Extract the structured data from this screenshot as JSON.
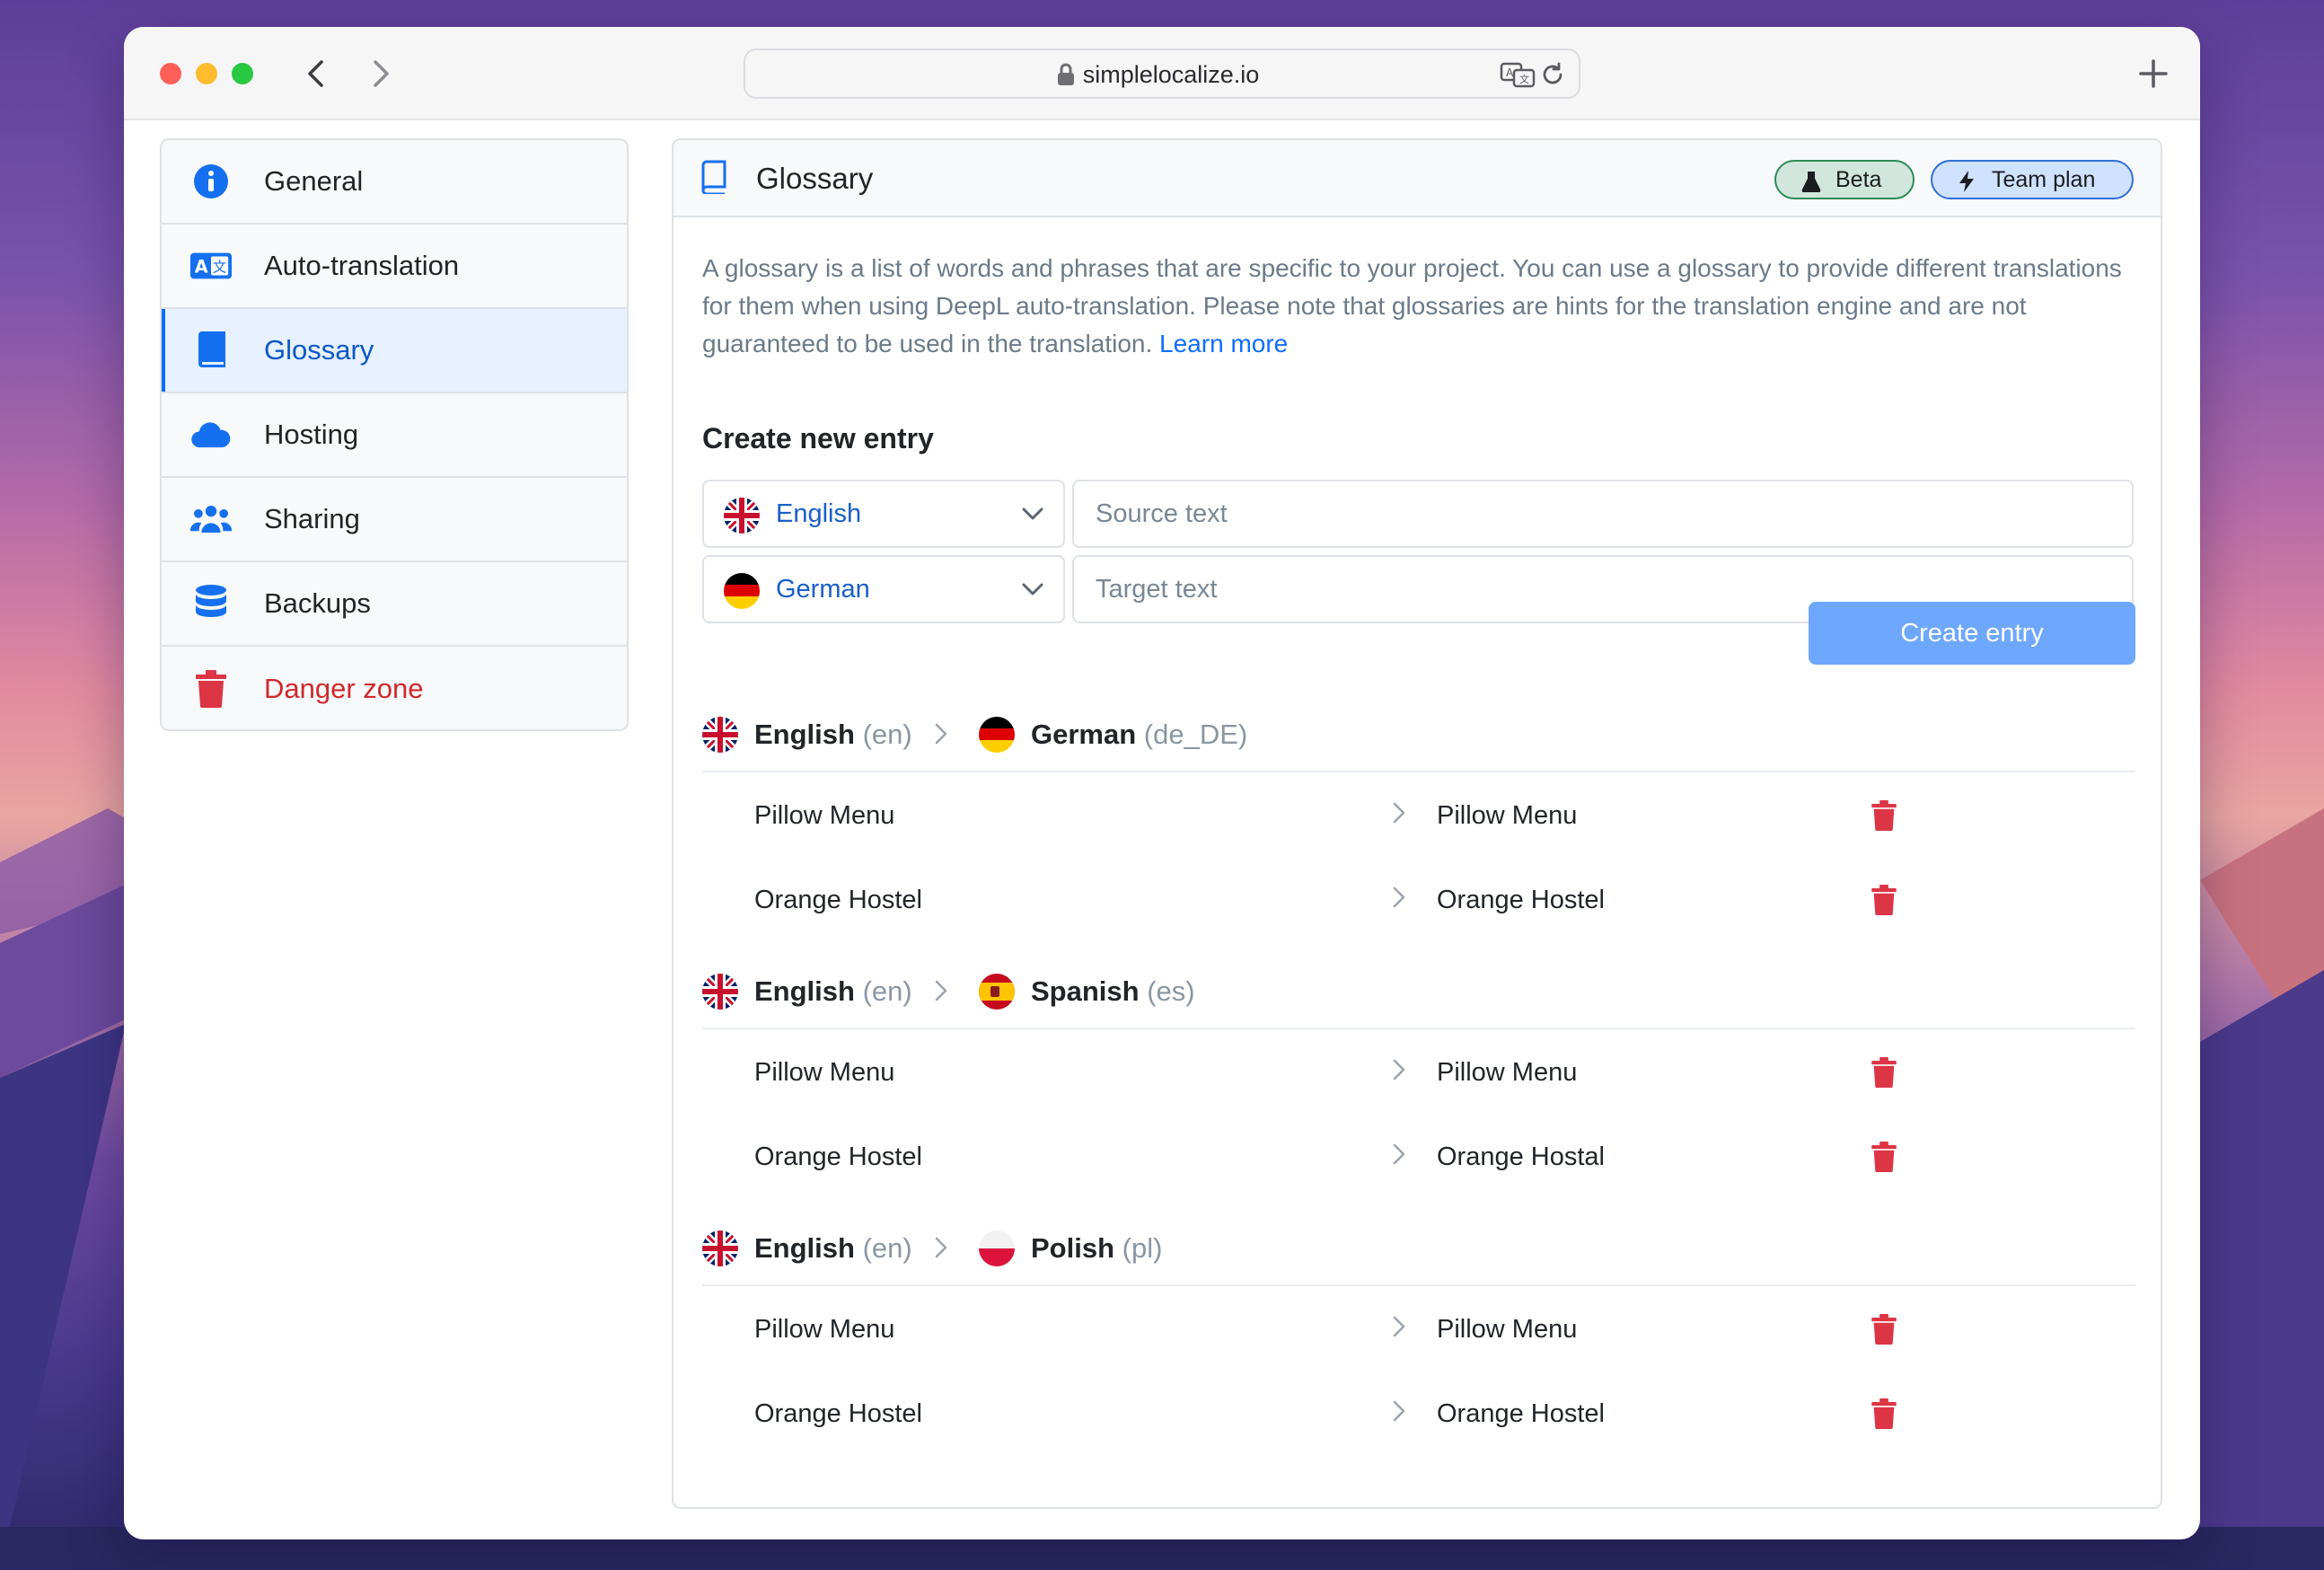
{
  "browser": {
    "url": "simplelocalize.io"
  },
  "sidebar": {
    "items": [
      {
        "label": "General",
        "icon": "info-icon"
      },
      {
        "label": "Auto-translation",
        "icon": "translate-icon"
      },
      {
        "label": "Glossary",
        "icon": "book-icon",
        "active": true
      },
      {
        "label": "Hosting",
        "icon": "cloud-icon"
      },
      {
        "label": "Sharing",
        "icon": "users-icon"
      },
      {
        "label": "Backups",
        "icon": "database-icon"
      },
      {
        "label": "Danger zone",
        "icon": "trash-icon",
        "color": "#d0282c"
      }
    ]
  },
  "panel": {
    "title": "Glossary",
    "badges": {
      "beta": "Beta",
      "team": "Team plan"
    },
    "description": "A glossary is a list of words and phrases that are specific to your project. You can use a glossary to provide different translations for them when using DeepL auto-translation. Please note that glossaries are hints for the translation engine and are not guaranteed to be used in the translation.",
    "learn_more": "Learn more"
  },
  "create": {
    "title": "Create new entry",
    "source_language": "English",
    "target_language": "German",
    "source_placeholder": "Source text",
    "target_placeholder": "Target text",
    "button": "Create entry"
  },
  "groups": [
    {
      "source": "English",
      "source_code": "(en)",
      "target": "German",
      "target_code": "(de_DE)",
      "entries": [
        {
          "source": "Pillow Menu",
          "target": "Pillow Menu"
        },
        {
          "source": "Orange Hostel",
          "target": "Orange Hostel"
        }
      ]
    },
    {
      "source": "English",
      "source_code": "(en)",
      "target": "Spanish",
      "target_code": "(es)",
      "entries": [
        {
          "source": "Pillow Menu",
          "target": "Pillow Menu"
        },
        {
          "source": "Orange Hostel",
          "target": "Orange Hostal"
        }
      ]
    },
    {
      "source": "English",
      "source_code": "(en)",
      "target": "Polish",
      "target_code": "(pl)",
      "entries": [
        {
          "source": "Pillow Menu",
          "target": "Pillow Menu"
        },
        {
          "source": "Orange Hostel",
          "target": "Orange Hostel"
        }
      ]
    }
  ],
  "colors": {
    "accent": "#0d6efd",
    "danger": "#dc3545",
    "button": "#6ea8fe"
  }
}
